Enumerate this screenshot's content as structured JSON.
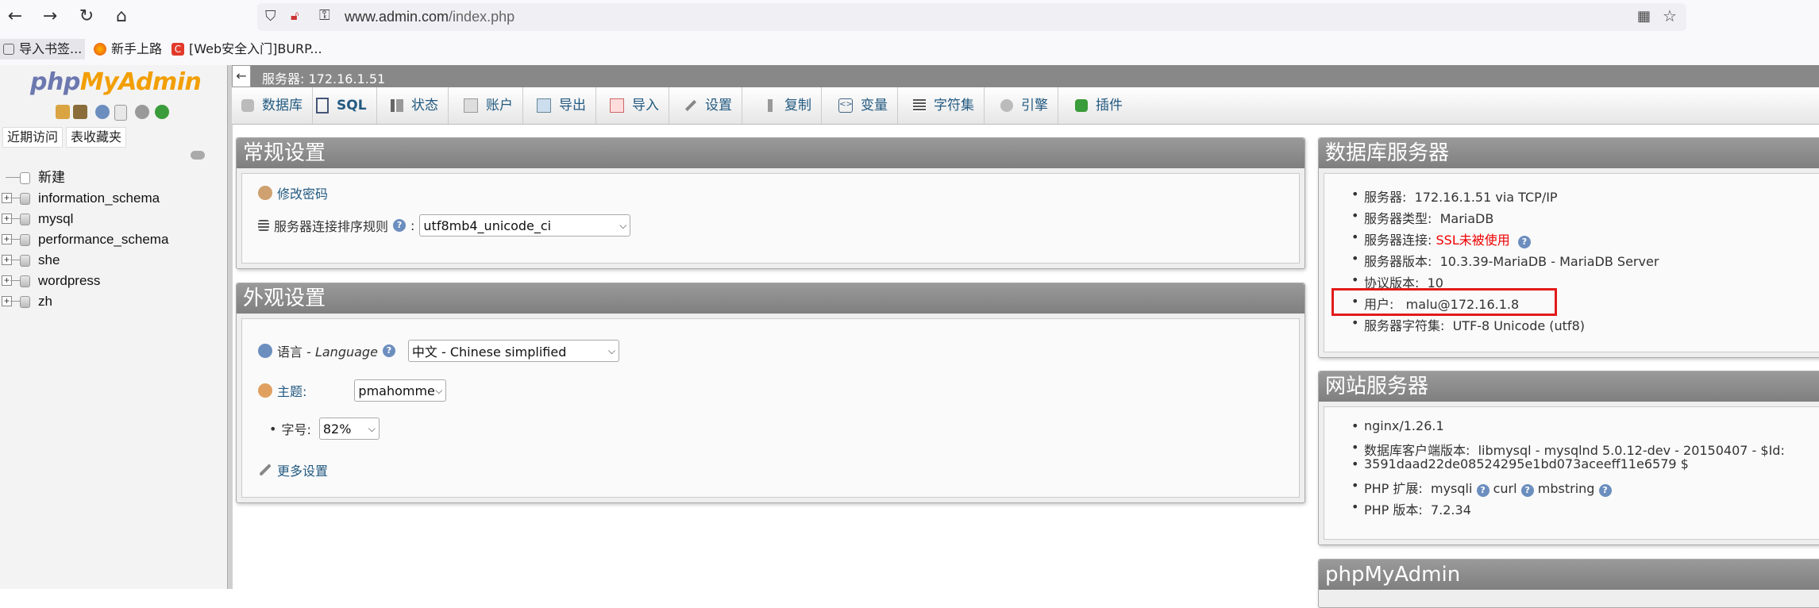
{
  "browser": {
    "url_host": "www.admin.com",
    "url_path": "/index.php",
    "bookmarks": [
      "导入书签...",
      "新手上路",
      "[Web安全入门]BURP..."
    ]
  },
  "nav": {
    "logo_php": "php",
    "logo_myadmin": "MyAdmin",
    "recent": "近期访问",
    "favorites": "表收藏夹",
    "tree": [
      "新建",
      "information_schema",
      "mysql",
      "performance_schema",
      "she",
      "wordpress",
      "zh"
    ]
  },
  "server_bar": "服务器: 172.16.1.51",
  "tabs": [
    "数据库",
    "SQL",
    "状态",
    "账户",
    "导出",
    "导入",
    "设置",
    "复制",
    "变量",
    "字符集",
    "引擎",
    "插件"
  ],
  "general": {
    "title": "常规设置",
    "change_password": "修改密码",
    "collation_label": "服务器连接排序规则",
    "collation_value": "utf8mb4_unicode_ci"
  },
  "appearance": {
    "title": "外观设置",
    "language_label": "语言 - ",
    "language_label_en": "Language",
    "language_value": "中文 - Chinese simplified",
    "theme_label": "主题:",
    "theme_value": "pmahomme",
    "fontsize_label": "字号:",
    "fontsize_value": "82%",
    "more_settings": "更多设置"
  },
  "db_server": {
    "title": "数据库服务器",
    "items": [
      {
        "label": "服务器:",
        "value": "172.16.1.51 via TCP/IP"
      },
      {
        "label": "服务器类型:",
        "value": "MariaDB"
      },
      {
        "label": "服务器连接:",
        "value": "SSL未被使用"
      },
      {
        "label": "服务器版本:",
        "value": "10.3.39-MariaDB - MariaDB Server"
      },
      {
        "label": "协议版本:",
        "value": "10"
      },
      {
        "label": "用户:",
        "value": "malu@172.16.1.8"
      },
      {
        "label": "服务器字符集:",
        "value": "UTF-8 Unicode (utf8)"
      }
    ]
  },
  "web_server": {
    "title": "网站服务器",
    "nginx": "nginx/1.26.1",
    "client_label": "数据库客户端版本:",
    "client_value_1": "libmysql - mysqlnd 5.0.12-dev - 20150407 - $Id:",
    "client_value_2": "3591daad22de08524295e1bd073aceeff11e6579 $",
    "php_ext_label": "PHP 扩展:",
    "php_ext_1": "mysqli",
    "php_ext_2": "curl",
    "php_ext_3": "mbstring",
    "php_ver_label": "PHP 版本:",
    "php_ver_value": "7.2.34"
  },
  "pma_panel": {
    "title": "phpMyAdmin"
  },
  "colors": {
    "link": "#235a81",
    "highlight": "#e21b1b",
    "logo_blue": "#6c78af",
    "logo_orange": "#f29f05"
  }
}
